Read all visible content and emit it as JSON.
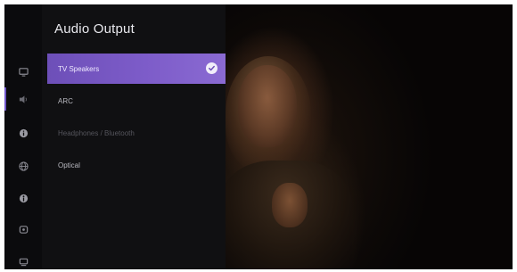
{
  "panel": {
    "title": "Audio Output",
    "options": [
      {
        "label": "TV Speakers",
        "selected": true
      },
      {
        "label": "ARC",
        "selected": false
      },
      {
        "label": "Headphones / Bluetooth",
        "selected": false,
        "disabled": true
      },
      {
        "label": "Optical",
        "selected": false
      }
    ]
  },
  "rail": {
    "icons": [
      "picture-icon",
      "sound-icon",
      "info-icon",
      "network-icon",
      "accessibility-icon",
      "display-icon",
      "system-icon"
    ],
    "active_index": 1
  },
  "colors": {
    "accent": "#7a5ac6",
    "panel_bg": "#101012",
    "rail_bg": "#0b0b0d"
  }
}
